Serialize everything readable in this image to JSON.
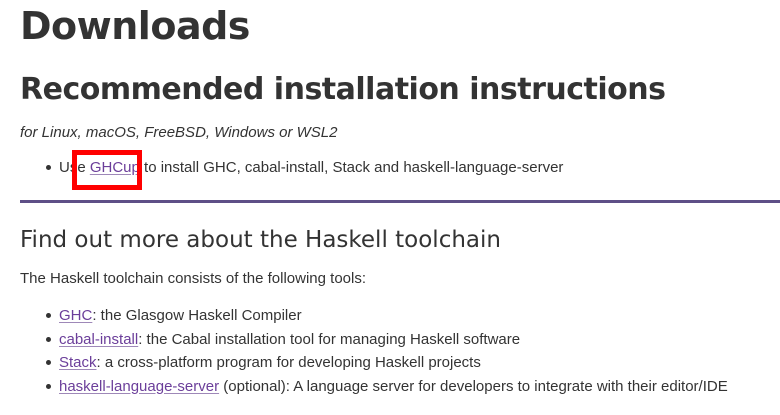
{
  "page": {
    "title": "Downloads"
  },
  "recommended": {
    "heading": "Recommended installation instructions",
    "platforms": "for Linux, macOS, FreeBSD, Windows or WSL2",
    "item": {
      "prefix": "Use ",
      "link": "GHCup",
      "suffix": " to install GHC, cabal-install, Stack and haskell-language-server"
    }
  },
  "toolchain": {
    "heading": "Find out more about the Haskell toolchain",
    "intro": "The Haskell toolchain consists of the following tools:",
    "tools": [
      {
        "link": "GHC",
        "text": ": the Glasgow Haskell Compiler"
      },
      {
        "link": "cabal-install",
        "text": ": the Cabal installation tool for managing Haskell software"
      },
      {
        "link": "Stack",
        "text": ": a cross-platform program for developing Haskell projects"
      },
      {
        "link": "haskell-language-server",
        "text": " (optional): A language server for developers to integrate with their editor/IDE"
      }
    ]
  },
  "colors": {
    "text": "#333333",
    "link": "#6b3e9a",
    "divider": "#5e4f87",
    "highlight": "#ff0000"
  }
}
